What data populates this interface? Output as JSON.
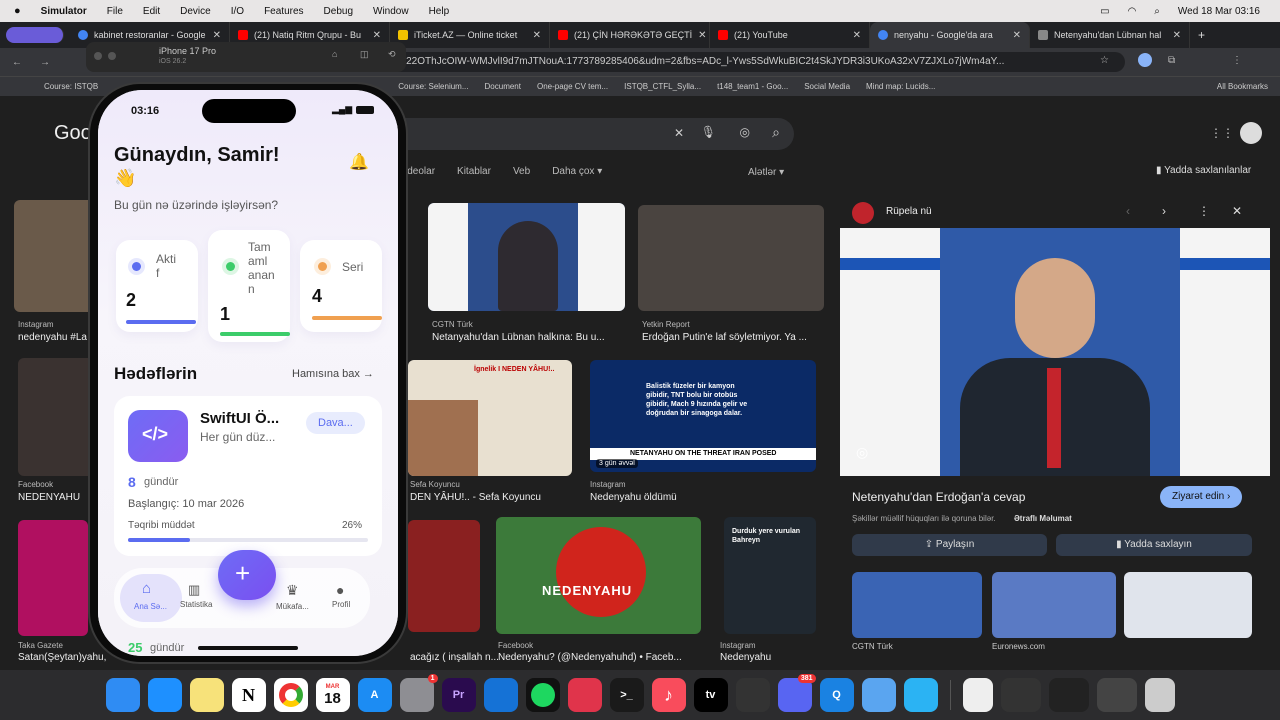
{
  "menubar": {
    "app": "Simulator",
    "items": [
      "File",
      "Edit",
      "Device",
      "I/O",
      "Features",
      "Debug",
      "Window",
      "Help"
    ],
    "clock": "Wed 18 Mar  03:16"
  },
  "browser": {
    "tabs": [
      {
        "label": "kabinet restoranlar - Google",
        "color": "#4285f4"
      },
      {
        "label": "(21) Natiq Ritm Qrupu - Bu",
        "color": "#ff0000"
      },
      {
        "label": "iTicket.AZ — Online ticket",
        "color": "#f2c200"
      },
      {
        "label": "(21) ÇİN HƏRƏKƏTƏ GEÇTİ",
        "color": "#ff0000"
      },
      {
        "label": "(21) YouTube",
        "color": "#ff0000"
      },
      {
        "label": "nenyahu - Google'da ara",
        "color": "#4285f4"
      },
      {
        "label": "Netenyahu'dan Lübnan hal",
        "color": "#888888"
      }
    ],
    "url": "n422OThJcOIW-WMJvlI9d7mJTNouA:1773789285406&udm=2&fbs=ADc_l-Yws5SdWkuBIC2t4SkJYDR3i3UKoA32xV7ZJXLo7jWm4aY...",
    "bookmarks": [
      "Course: ISTQB",
      "Course: Selenium...",
      "Document",
      "One-page CV tem...",
      "ISTQB_CTFL_Sylla...",
      "t148_team1 - Goo...",
      "Social Media",
      "Mind map: Lucids..."
    ],
    "bookmarks_all": "All Bookmarks"
  },
  "google": {
    "logo": "Goo",
    "filters": [
      "videolar",
      "Kitablar",
      "Veb",
      "Daha çox"
    ],
    "tools": "Alətlər",
    "saved": "Yadda saxlanılanlar",
    "results": [
      {
        "src": "Instagram",
        "title": "nedenyahu #La"
      },
      {
        "src": "CGTN Türk",
        "title": "Netanyahu'dan Lübnan halkına: Bu u..."
      },
      {
        "src": "Yetkin Report",
        "title": "Erdoğan Putin'e laf söyletmiyor. Ya ..."
      },
      {
        "src": "Facebook",
        "title": "NEDENYAHU"
      },
      {
        "src": "Sefa Koyuncu",
        "title": "DEN YÂHU!.. - Sefa Koyuncu"
      },
      {
        "src": "Instagram",
        "title": "Nedenyahu öldümü"
      },
      {
        "src": "Taka Gazete",
        "title": "Satan(Şeytan)yahu,"
      },
      {
        "src": "",
        "title": "acağız ( inşallah n..."
      },
      {
        "src": "Facebook",
        "title": "Nedenyahu? (@Nedenyahuhd) • Faceb..."
      },
      {
        "src": "Instagram",
        "title": "Nedenyahu"
      }
    ],
    "overlay_texts": {
      "poem_title": "İgnelik I NEDEN YÂHU!..",
      "fox_ticker": "NETANYAHU ON THE THREAT IRAN POSED",
      "fox_time": "3 gün əvvəl",
      "fox_caption": "Balistik füzeler bir kamyon gibidir, TNT bolu bir otobüs gibidir, Mach 9 hızında gelir ve doğrudan bir sinagoga dalar.",
      "parrot": "NEDENYAHU",
      "video_caption": "Durduk yere vurulan Bahreyn"
    }
  },
  "panel": {
    "source": "Rüpela nü",
    "title": "Netenyahu'dan Erdoğan'a cevap",
    "visit": "Ziyarət edin",
    "copyright": "Şəkillər müəllif hüquqları ilə qoruna bilər.",
    "more_info": "Ətraflı Məlumat",
    "share": "Paylaşın",
    "save": "Yadda saxlayın",
    "related": [
      {
        "src": "CGTN Türk"
      },
      {
        "src": "Euronews.com"
      },
      {
        "src": ""
      }
    ]
  },
  "simulator": {
    "device": "iPhone 17 Pro",
    "os": "iOS 26.2"
  },
  "app": {
    "time": "03:16",
    "greeting": "Günaydın, Samir!",
    "wave": "👋",
    "subtitle": "Bu gün nə üzərində işləyirsən?",
    "stats": [
      {
        "label": "Akti\nf",
        "value": "2",
        "color": "#5b6cf0",
        "fill": 1
      },
      {
        "label": "Tam\naml\nanan\nn",
        "value": "1",
        "color": "#3ccc6a",
        "fill": 1
      },
      {
        "label": "Seri",
        "value": "4",
        "color": "#f0a050",
        "fill": 1
      }
    ],
    "goals_title": "Hədəflərin",
    "see_all": "Hamısına bax",
    "goal": {
      "name": "SwiftUI Ö...",
      "desc": "Her gün düz...",
      "status": "Dava...",
      "days": "8",
      "days_unit": "gündür",
      "start": "Başlangıç: 10 mar 2026",
      "progress_label": "Təqribi müddət",
      "progress_value": "26%",
      "progress": 0.26
    },
    "goal2": {
      "days": "25",
      "days_unit": "gündür"
    },
    "tabs": [
      "Ana Sə...",
      "Statistika",
      "",
      "Mükafa...",
      "Profil"
    ]
  },
  "dock": {
    "apps": [
      {
        "name": "finder",
        "color": "#2f8cf3",
        "glyph": ""
      },
      {
        "name": "safari",
        "color": "#1e90ff",
        "glyph": ""
      },
      {
        "name": "notes",
        "color": "#f7e27a",
        "glyph": ""
      },
      {
        "name": "notion",
        "color": "#ffffff",
        "glyph": "N"
      },
      {
        "name": "chrome",
        "color": "#ffffff",
        "glyph": ""
      },
      {
        "name": "calendar",
        "color": "#ffffff",
        "glyph": "18"
      },
      {
        "name": "app-store",
        "color": "#1c8cf3",
        "glyph": "A"
      },
      {
        "name": "system-settings",
        "color": "#8e8e93",
        "glyph": ""
      },
      {
        "name": "premiere",
        "color": "#2a0b4e",
        "glyph": "Pr"
      },
      {
        "name": "xcode",
        "color": "#1572d6",
        "glyph": ""
      },
      {
        "name": "spotify",
        "color": "#111111",
        "glyph": ""
      },
      {
        "name": "screen-recorder",
        "color": "#e0344b",
        "glyph": ""
      },
      {
        "name": "terminal",
        "color": "#1a1a1a",
        "glyph": ">_"
      },
      {
        "name": "music",
        "color": "#f94c5c",
        "glyph": "♪"
      },
      {
        "name": "apple-tv",
        "color": "#000000",
        "glyph": "tv"
      },
      {
        "name": "obs",
        "color": "#333333",
        "glyph": ""
      },
      {
        "name": "discord",
        "color": "#5865f2",
        "glyph": ""
      },
      {
        "name": "quicktime",
        "color": "#1a82e2",
        "glyph": "Q"
      },
      {
        "name": "simulator",
        "color": "#5aa5f0",
        "glyph": ""
      },
      {
        "name": "app-window",
        "color": "#2bb3f3",
        "glyph": ""
      }
    ],
    "badges": {
      "settings": "1",
      "discord": "381"
    },
    "calendar_month": "MAR"
  }
}
